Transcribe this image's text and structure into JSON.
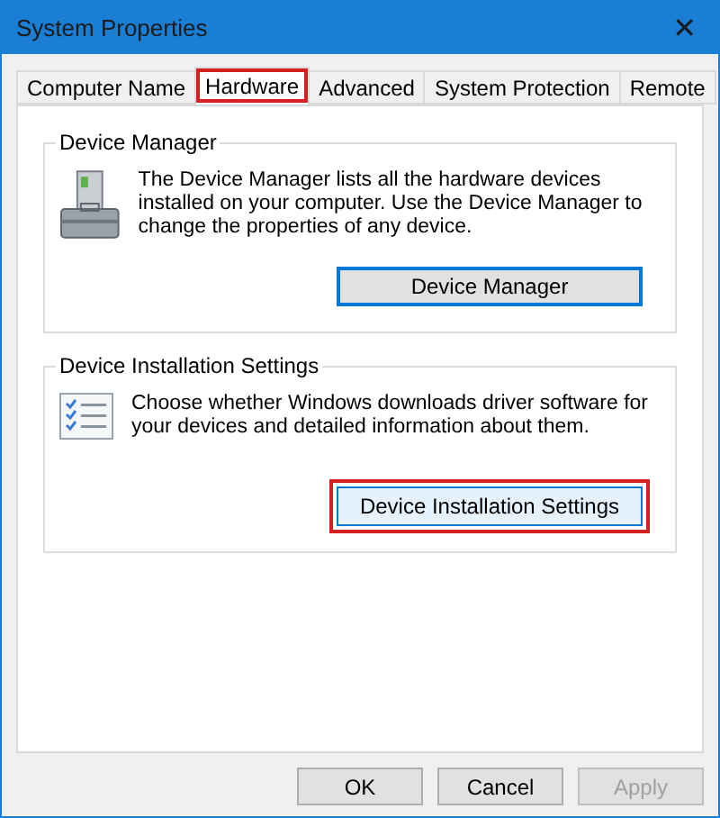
{
  "window": {
    "title": "System Properties",
    "close": "✕"
  },
  "tabs": [
    {
      "label": "Computer Name",
      "selected": false,
      "highlighted": false
    },
    {
      "label": "Hardware",
      "selected": true,
      "highlighted": true
    },
    {
      "label": "Advanced",
      "selected": false,
      "highlighted": false
    },
    {
      "label": "System Protection",
      "selected": false,
      "highlighted": false
    },
    {
      "label": "Remote",
      "selected": false,
      "highlighted": false
    }
  ],
  "groups": [
    {
      "kind": "device-manager",
      "title": "Device Manager",
      "text": "The Device Manager lists all the hardware devices installed on your computer. Use the Device Manager to change the properties of any device.",
      "button": {
        "label": "Device Manager",
        "focused": true,
        "hovered": false,
        "highlighted": false
      }
    },
    {
      "kind": "checklist",
      "title": "Device Installation Settings",
      "text": "Choose whether Windows downloads driver software for your devices and detailed information about them.",
      "button": {
        "label": "Device Installation Settings",
        "focused": false,
        "hovered": true,
        "highlighted": true
      }
    }
  ],
  "buttons": [
    {
      "label": "OK",
      "disabled": false
    },
    {
      "label": "Cancel",
      "disabled": false
    },
    {
      "label": "Apply",
      "disabled": true
    }
  ]
}
